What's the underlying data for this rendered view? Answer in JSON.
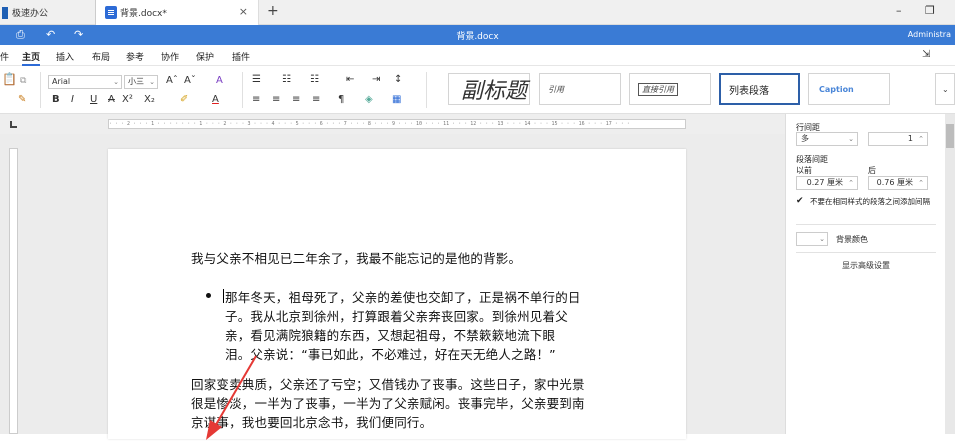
{
  "tabs": {
    "app_label": "极速办公",
    "doc_label": "背景.docx*",
    "close_glyph": "×",
    "add_glyph": "+"
  },
  "window": {
    "minimize": "–",
    "restore": "❐"
  },
  "titlebar": {
    "title": "背景.docx",
    "user": "Administra"
  },
  "menu": {
    "items": [
      "件",
      "主页",
      "插入",
      "布局",
      "参考",
      "协作",
      "保护",
      "插件"
    ],
    "active": "主页"
  },
  "ribbon": {
    "font_name": "Arial",
    "font_size": "小三",
    "bold": "B",
    "italic": "I",
    "underline": "U",
    "styles": {
      "subtitle": "副标题",
      "quote": "引用",
      "intense_quote": "直接引用",
      "list_paragraph": "列表段落",
      "caption": "Caption"
    }
  },
  "ruler": {
    "text": "· · · 2 · · · 1 · · · ·  · · · 1 · · · 2 · · · 3 · · · 4 · · · 5 · · · 6 · · · 7 · · · 8 · · · 9 · · · 10 · · · 11 · · · 12 · · · 13 · · · 14 · · · 15 · · · 16 · · · 17 · · ·"
  },
  "document": {
    "para1": "我与父亲不相见已二年余了，我最不能忘记的是他的背影。",
    "para2_lines": [
      "那年冬天，祖母死了，父亲的差使也交卸了，正是祸不单行的日",
      "子。我从北京到徐州，打算跟着父亲奔丧回家。到徐州见着父",
      "亲，看见满院狼籍的东西，又想起祖母，不禁簌簌地流下眼",
      "泪。父亲说：“事已如此，不必难过，好在天无绝人之路！”"
    ],
    "para3_lines": [
      "回家变卖典质，父亲还了亏空；又借钱办了丧事。这些日子，家中光景",
      "很是惨淡，一半为了丧事，一半为了父亲赋闲。丧事完毕，父亲要到南",
      "京谋事，我也要回北京念书，我们便同行。"
    ]
  },
  "right_panel": {
    "line_spacing_label": "行间距",
    "line_spacing_mode": "多",
    "line_spacing_value": "1",
    "para_spacing_label": "段落间距",
    "before_label": "以前",
    "after_label": "后",
    "before_value": "0.27 厘米",
    "after_value": "0.76 厘米",
    "checkbox_label": "不要在相同样式的段落之间添加间隔",
    "bg_color_label": "背景颜色",
    "advanced_link": "显示高级设置"
  },
  "colors": {
    "titlebar": "#3a7bd5",
    "accent": "#2d6bd6",
    "annotation_arrow": "#e53935"
  }
}
